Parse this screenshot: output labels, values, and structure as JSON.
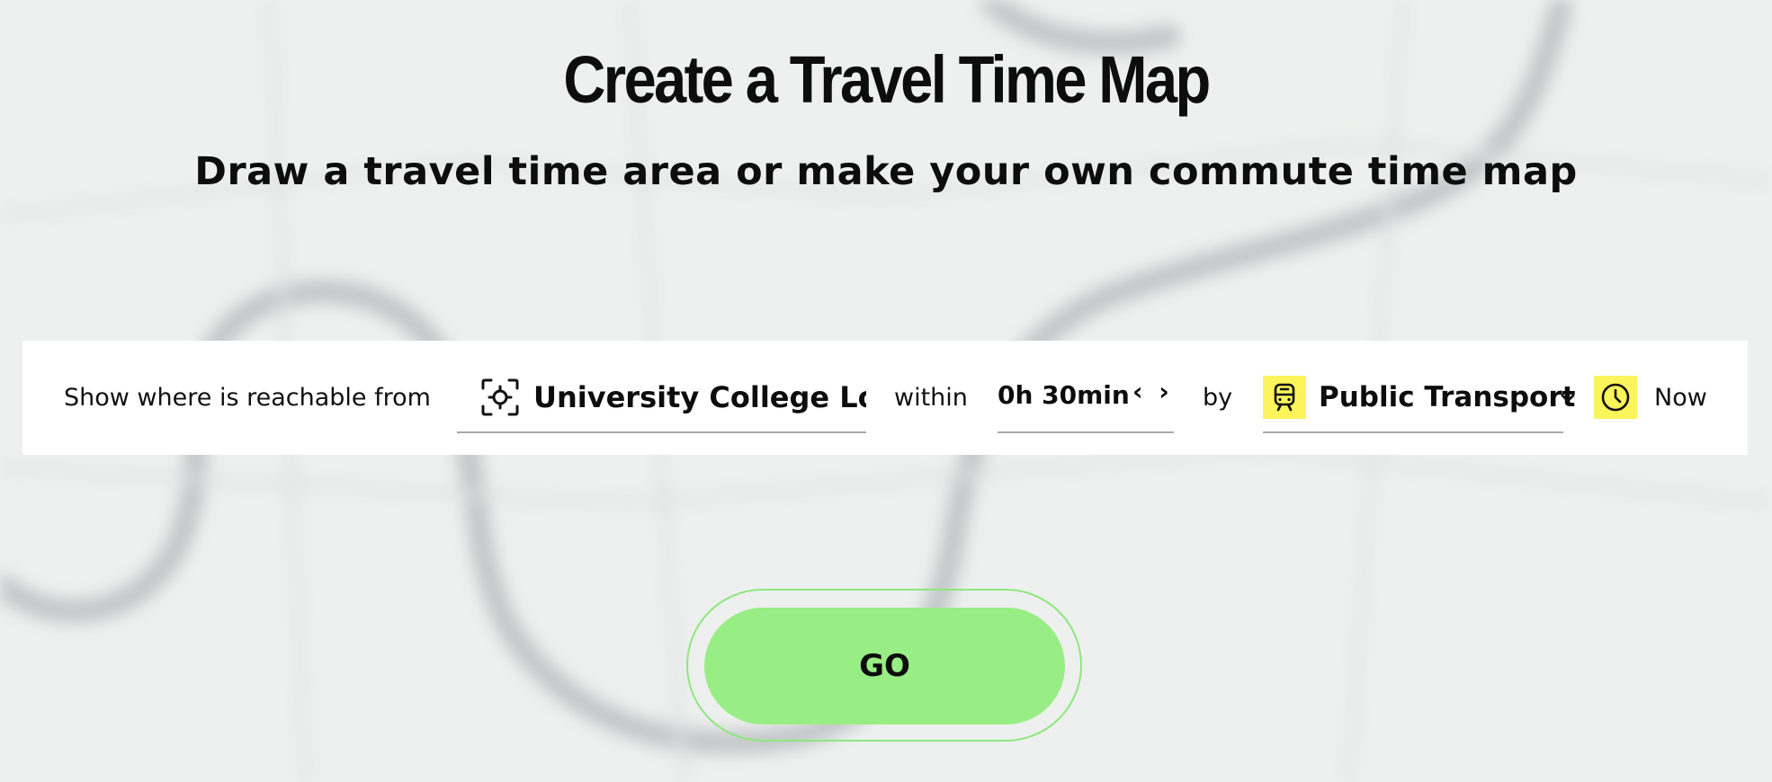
{
  "header": {
    "title": "Create a Travel Time Map",
    "subtitle": "Draw a travel time area or make your own commute time map"
  },
  "form": {
    "prefix_label": "Show where is reachable from",
    "location": {
      "value": "University College Lond...",
      "icon": "crosshair-location-icon"
    },
    "within_label": "within",
    "duration": {
      "value": "0h 30min",
      "arrows": "‹ ›"
    },
    "by_label": "by",
    "transport_mode": {
      "value": "Public Transport",
      "icon": "train-icon"
    },
    "time": {
      "value": "Now",
      "icon": "clock-icon"
    }
  },
  "go_button": {
    "label": "GO"
  },
  "colors": {
    "accent_yellow": "#fbf45b",
    "go_green": "#98ee84",
    "go_ring": "#8ee77e",
    "background": "#eef0ef"
  }
}
